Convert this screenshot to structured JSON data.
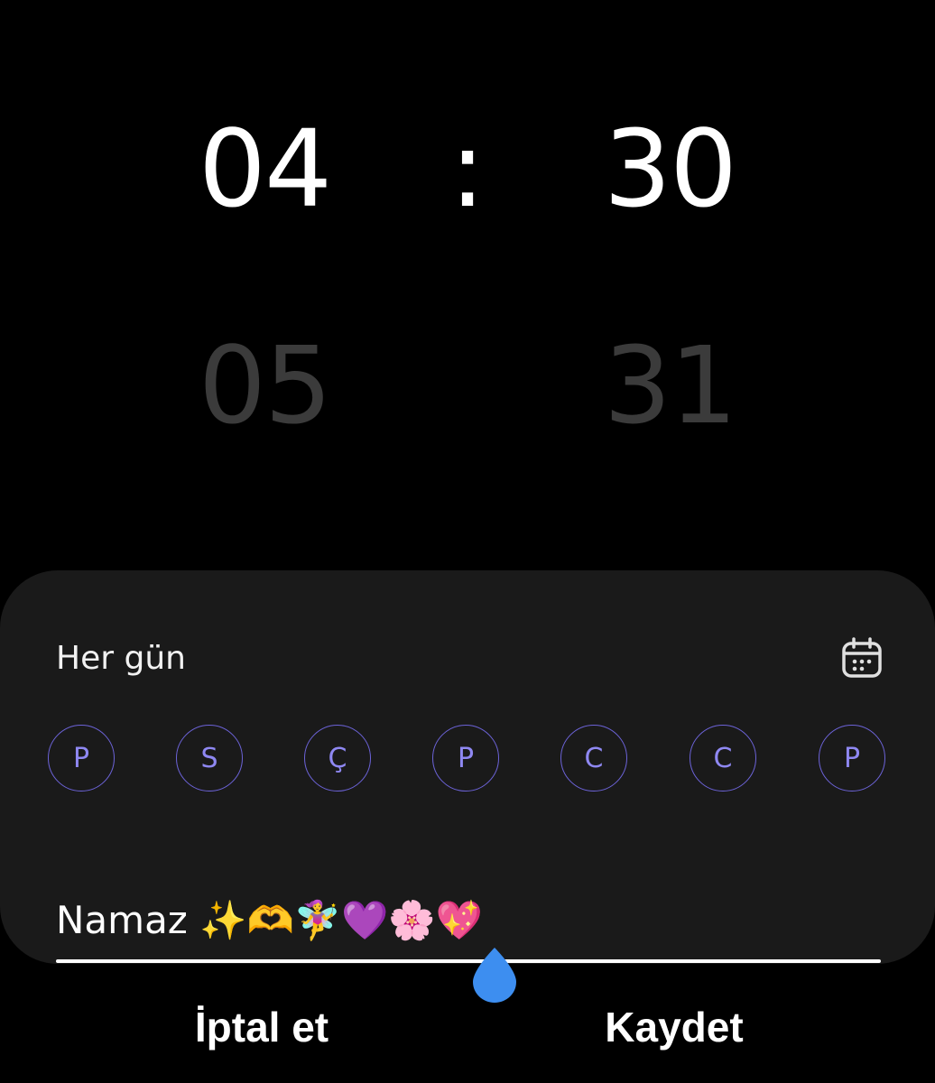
{
  "time_picker": {
    "hour_selected": "04",
    "minute_selected": "30",
    "separator": ":",
    "hour_next": "05",
    "minute_next": "31"
  },
  "repeat": {
    "label": "Her gün",
    "calendar_icon": "calendar-icon"
  },
  "days": [
    {
      "label": "P"
    },
    {
      "label": "S"
    },
    {
      "label": "Ç"
    },
    {
      "label": "P"
    },
    {
      "label": "C"
    },
    {
      "label": "C"
    },
    {
      "label": "P"
    }
  ],
  "alarm_name": {
    "value": "Namaz ✨🫶🧚‍♀️💜🌸💖"
  },
  "footer": {
    "cancel_label": "İptal et",
    "save_label": "Kaydet"
  },
  "colors": {
    "background": "#000000",
    "panel": "#1a1a1a",
    "day_accent": "#8f88f2",
    "cursor_handle": "#3d8ef0"
  }
}
